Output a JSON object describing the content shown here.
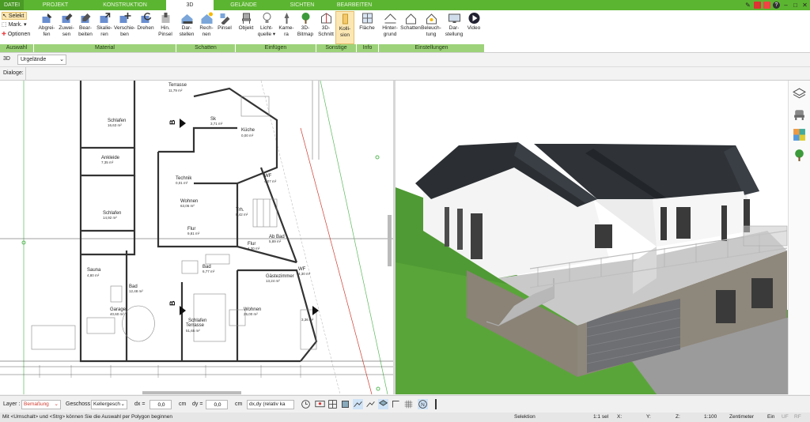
{
  "tabs": [
    {
      "label": "DATEI"
    },
    {
      "label": "PROJEKT"
    },
    {
      "label": "KONSTRUKTION"
    },
    {
      "label": "3D"
    },
    {
      "label": "GELÄNDE"
    },
    {
      "label": "SICHTEN"
    },
    {
      "label": "BEARBEITEN"
    }
  ],
  "ribbon": {
    "selekt": "Selekt",
    "mark": "Mark.",
    "optionen": "Optionen",
    "buttons": [
      {
        "label": "Abgrei-\nfen"
      },
      {
        "label": "Zuwei-\nsen"
      },
      {
        "label": "Bear-\nbeiten"
      },
      {
        "label": "Skalie-\nren"
      },
      {
        "label": "Verschie-\nben"
      },
      {
        "label": "Drehen"
      },
      {
        "label": "Hin.\nPinsel"
      },
      {
        "label": "Dar-\nstellen"
      },
      {
        "label": "Rech-\nnen"
      },
      {
        "label": "Pinsel"
      },
      {
        "label": "Objekt"
      },
      {
        "label": "Licht-\nquelle ▾"
      },
      {
        "label": "Kame-\nra"
      },
      {
        "label": "3D-\nBitmap"
      },
      {
        "label": "3D-\nSchnitt"
      },
      {
        "label": "Kolli-\nsion"
      },
      {
        "label": "Fläche"
      },
      {
        "label": "Hinter-\ngrund"
      },
      {
        "label": "Schatten"
      },
      {
        "label": "Beleuch-\ntung"
      },
      {
        "label": "Dar-\nstellung"
      },
      {
        "label": "Video"
      }
    ],
    "groups": [
      "Auswahl",
      "Material",
      "Schatten",
      "Einfügen",
      "Sonstige",
      "Info",
      "Einstellungen"
    ]
  },
  "toolbar": {
    "view_mode": "3D",
    "terrain": "Urgelände",
    "dialoge": "Dialoge:"
  },
  "plan": {
    "rooms": [
      {
        "name": "Terrasse",
        "area": "11,79 m²"
      },
      {
        "name": "Schlafen",
        "area": "16,63 m²"
      },
      {
        "name": "Sk",
        "area": "3,71 m²"
      },
      {
        "name": "Küche",
        "area": "0,00 m²"
      },
      {
        "name": "Ankleide",
        "area": "7,35 m²"
      },
      {
        "name": "Technik",
        "area": "0,01 m²"
      },
      {
        "name": "WF",
        "area": "4,07 m²"
      },
      {
        "name": "Wohnen",
        "area": "63,06 m²"
      },
      {
        "name": "Schlafen",
        "area": "14,92 m²"
      },
      {
        "name": "Trh.",
        "area": "8,42 m²"
      },
      {
        "name": "Flur",
        "area": "9,81 m²"
      },
      {
        "name": "Flur",
        "area": "4,30 m²"
      },
      {
        "name": "Ab Bad",
        "area": "5,89 m²"
      },
      {
        "name": "Sauna",
        "area": "4,80 m²"
      },
      {
        "name": "Bad",
        "area": "6,77 m²"
      },
      {
        "name": "WF",
        "area": "4,30 m²"
      },
      {
        "name": "Bad",
        "area": "12,48 m²"
      },
      {
        "name": "Gästezimmer",
        "area": "13,24 m²"
      },
      {
        "name": "Garage",
        "area": "40,60 m²"
      },
      {
        "name": "Schlafen",
        "area": ""
      },
      {
        "name": "Terrasse",
        "area": "51,65 m²"
      },
      {
        "name": "Wohnen",
        "area": "25,00 m²"
      }
    ],
    "marks": [
      "B",
      "B"
    ],
    "dim": "3,36 m²"
  },
  "statusbar": {
    "layer_label": "Layer :",
    "layer_value": "Bemaßung",
    "geschoss_label": "Geschoss :",
    "geschoss_value": "Kellergesch",
    "dx_label": "dx =",
    "dx_value": "0,0",
    "dy_label": "dy =",
    "dy_value": "0,0",
    "unit": "cm",
    "mode": "dx,dy (relativ ka"
  },
  "infobar": {
    "hint": "Mit <Umschalt> und <Strg> können Sie die Auswahl per Polygon beginnen",
    "selektion": "Selektion",
    "ratio": "1:1 sel",
    "x": "X:",
    "y": "Y:",
    "z": "Z:",
    "scale": "1:100",
    "unit": "Zentimeter",
    "ein": "Ein",
    "uf": "UF",
    "rf": "RF"
  },
  "colors": {
    "accent": "#5cb531",
    "ribbon_group": "#9ed27a",
    "roof": "#2b2f33",
    "grass": "#4f9a34",
    "active_tab": "#ffffff",
    "dim_red": "#d13b2e"
  }
}
